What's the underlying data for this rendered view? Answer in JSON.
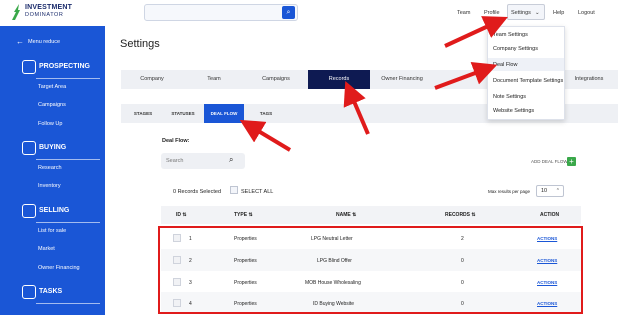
{
  "brand": {
    "line1": "INVESTMENT",
    "line2": "DOMINATOR"
  },
  "sidebar": {
    "menu_reduce": "Menu reduce",
    "sections": [
      {
        "label": "PROSPECTING",
        "icon": "target-icon",
        "items": [
          "Target Area",
          "Campaigns",
          "Follow Up"
        ]
      },
      {
        "label": "BUYING",
        "icon": "cart-icon",
        "items": [
          "Research",
          "Inventory"
        ]
      },
      {
        "label": "SELLING",
        "icon": "listing-icon",
        "items": [
          "List for sale",
          "Market",
          "Owner Financing"
        ]
      },
      {
        "label": "TASKS",
        "icon": "checklist-icon",
        "items": []
      }
    ]
  },
  "topnav": {
    "team": "Team",
    "profile": "Profile",
    "settings": "Settings",
    "help": "Help",
    "logout": "Logout"
  },
  "page_title": "Settings",
  "tabs": [
    "Company",
    "Team",
    "Campaigns",
    "Records",
    "Owner Financing",
    "Integrations"
  ],
  "active_tab": "Records",
  "settings_menu": [
    "Team Settings",
    "Company Settings",
    "Deal Flow",
    "Document Template Settings",
    "Note Settings",
    "Website Settings"
  ],
  "subtabs": [
    "STAGES",
    "STATUSES",
    "DEAL FLOW",
    "TAGS"
  ],
  "active_subtab": "DEAL FLOW",
  "deal_flow": {
    "title": "Deal Flow:",
    "search_placeholder": "Search",
    "add_label": "ADD DEAL FLOW",
    "selected": "0 Records Selected",
    "select_all": "SELECT ALL",
    "max_label": "Max results per page",
    "max_value": "10"
  },
  "table": {
    "headers": [
      "ID",
      "TYPE",
      "NAME",
      "RECORDS",
      "ACTION"
    ],
    "rows": [
      {
        "id": "1",
        "type": "Properties",
        "name": "LPG Neutral Letter",
        "records": "2",
        "action": "ACTIONS"
      },
      {
        "id": "2",
        "type": "Properties",
        "name": "LPG Blind Offer",
        "records": "0",
        "action": "ACTIONS"
      },
      {
        "id": "3",
        "type": "Properties",
        "name": "MOB House Wholesaling",
        "records": "0",
        "action": "ACTIONS"
      },
      {
        "id": "4",
        "type": "Properties",
        "name": "ID Buying Website",
        "records": "0",
        "action": "ACTIONS"
      }
    ]
  },
  "colors": {
    "primary": "#1a56d6",
    "navy": "#0e1a52",
    "annotation": "#e01b1b",
    "add": "#3aa84a"
  }
}
